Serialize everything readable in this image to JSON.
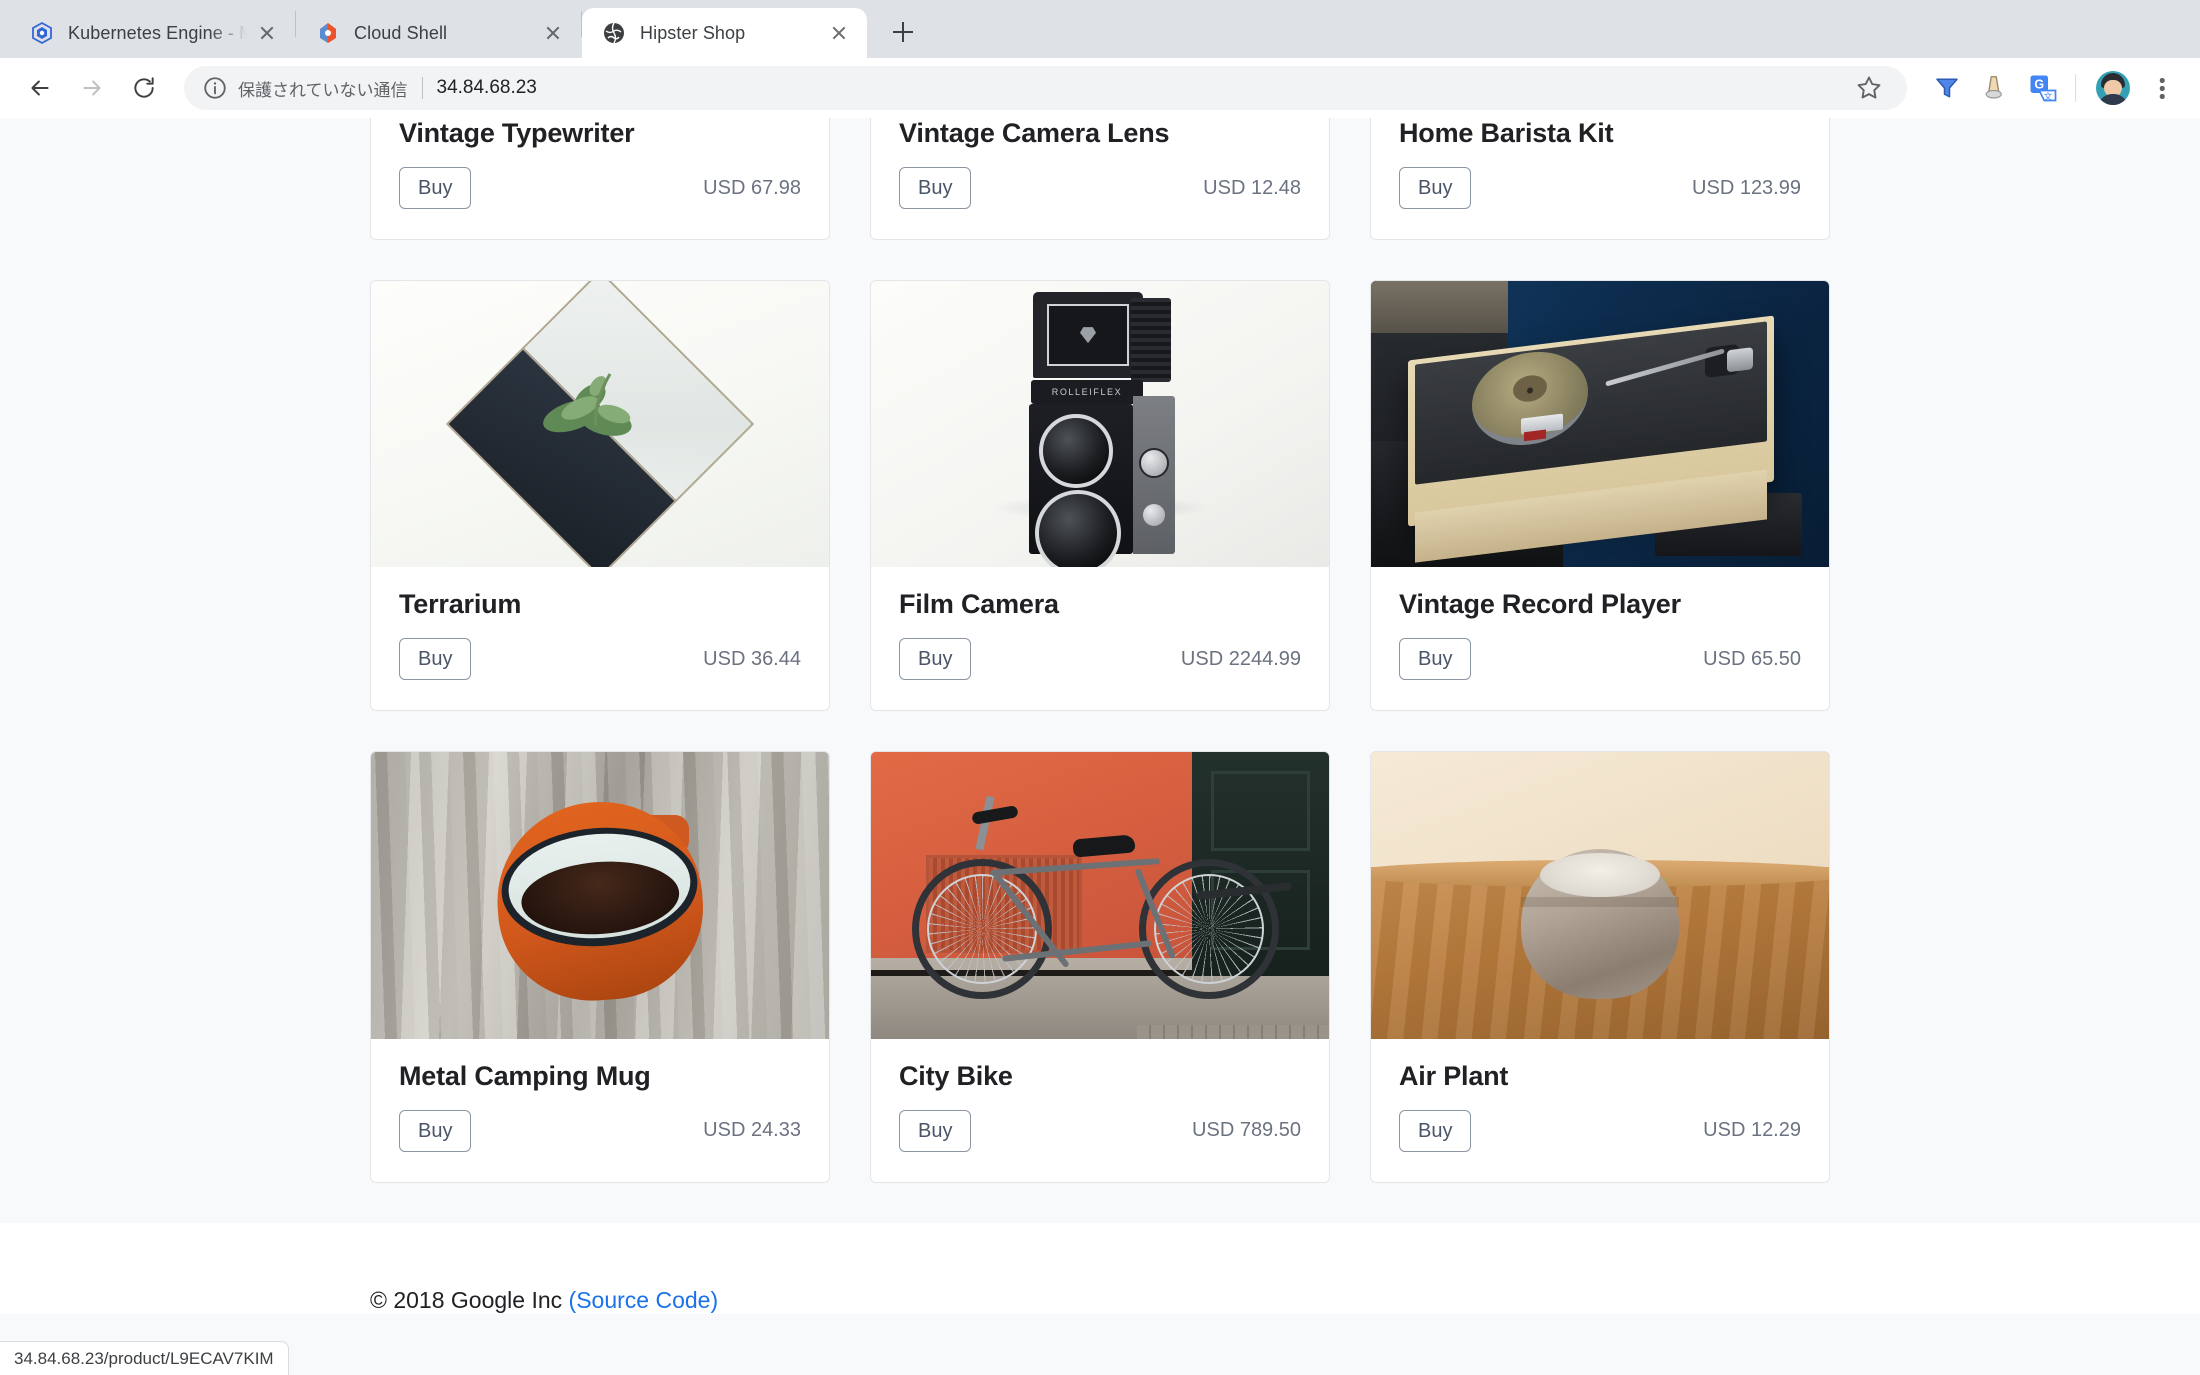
{
  "browser": {
    "tabs": [
      {
        "title": "Kubernetes Engine - My Projec",
        "favicon": "kubernetes-icon",
        "active": false
      },
      {
        "title": "Cloud Shell",
        "favicon": "cloud-shell-icon",
        "active": false
      },
      {
        "title": "Hipster Shop",
        "favicon": "globe-icon",
        "active": true
      }
    ],
    "new_tab_label": "+",
    "toolbar": {
      "back_icon": "back-arrow-icon",
      "forward_icon": "forward-arrow-icon",
      "reload_icon": "reload-icon",
      "security_icon": "info-circle-icon",
      "security_text": "保護されていない通信",
      "url": "34.84.68.23",
      "bookmark_icon": "star-icon",
      "extension_icons": [
        "extension-icon",
        "extension-icon"
      ],
      "translate_icon": "google-translate-icon",
      "avatar_icon": "profile-avatar",
      "menu_icon": "kebab-menu-icon"
    }
  },
  "status_bar": {
    "url": "34.84.68.23/product/L9ECAV7KIM"
  },
  "catalog": {
    "buy_label": "Buy",
    "currency": "USD",
    "rows": [
      {
        "clipped": true,
        "products": [
          {
            "name": "Vintage Typewriter",
            "price": "USD 67.98",
            "image": "vintage-typewriter-photo"
          },
          {
            "name": "Vintage Camera Lens",
            "price": "USD 12.48",
            "image": "vintage-camera-lens-photo"
          },
          {
            "name": "Home Barista Kit",
            "price": "USD 123.99",
            "image": "home-barista-kit-photo"
          }
        ]
      },
      {
        "clipped": false,
        "products": [
          {
            "name": "Terrarium",
            "price": "USD 36.44",
            "image": "terrarium-photo"
          },
          {
            "name": "Film Camera",
            "price": "USD 2244.99",
            "image": "film-camera-photo"
          },
          {
            "name": "Vintage Record Player",
            "price": "USD 65.50",
            "image": "record-player-photo"
          }
        ]
      },
      {
        "clipped": false,
        "products": [
          {
            "name": "Metal Camping Mug",
            "price": "USD 24.33",
            "image": "camping-mug-photo"
          },
          {
            "name": "City Bike",
            "price": "USD 789.50",
            "image": "city-bike-photo"
          },
          {
            "name": "Air Plant",
            "price": "USD 12.29",
            "image": "air-plant-photo"
          }
        ]
      }
    ]
  },
  "footer": {
    "copyright": "© 2018 Google Inc",
    "source_link": "(Source Code)"
  },
  "colors": {
    "link": "#1a73e8",
    "page_bg": "#f8f9fa",
    "card_bg": "#ffffff",
    "card_border": "#e3e5e8",
    "title": "#202124",
    "price": "#6b7280"
  }
}
